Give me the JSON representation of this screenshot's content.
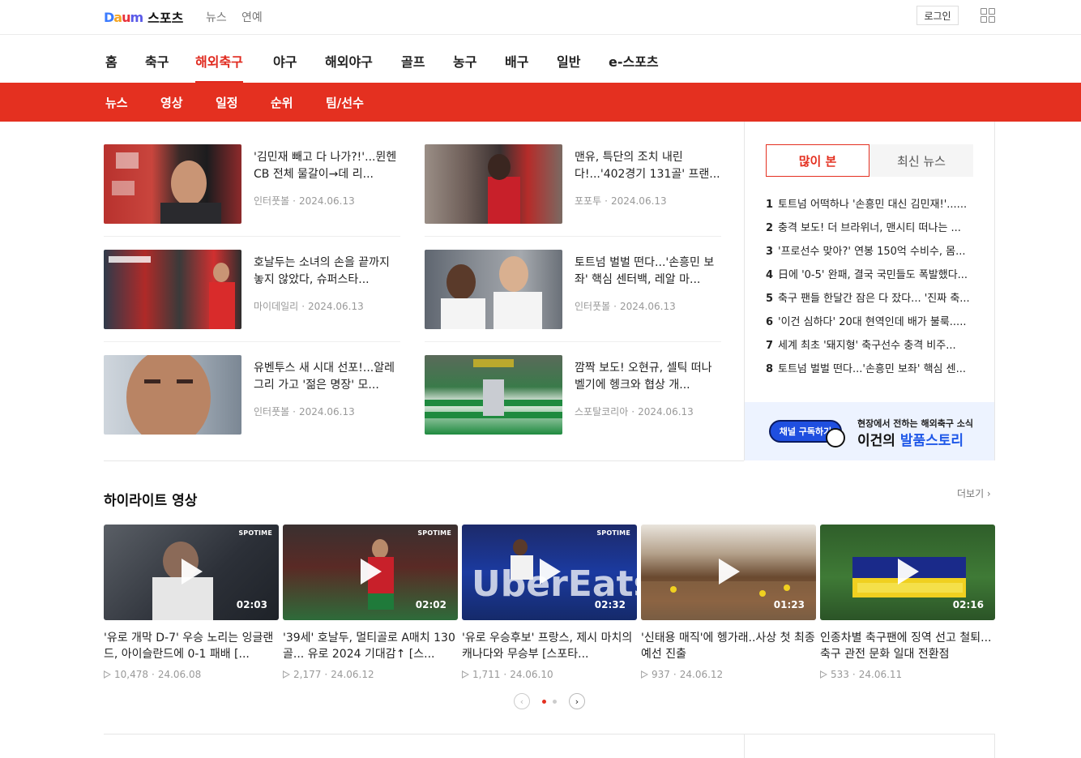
{
  "header": {
    "logo_daum": "Daum",
    "logo_section": "스포츠",
    "links": [
      "뉴스",
      "연예"
    ],
    "login_label": "로그인"
  },
  "main_nav": {
    "items": [
      "홈",
      "축구",
      "해외축구",
      "야구",
      "해외야구",
      "골프",
      "농구",
      "배구",
      "일반",
      "e-스포츠"
    ],
    "active": "해외축구"
  },
  "sub_nav": {
    "items": [
      "뉴스",
      "영상",
      "일정",
      "순위",
      "팀/선수"
    ]
  },
  "news": [
    {
      "title": "'김민재 빼고 다 나가?!'...뮌헨 CB 전체 물갈이→데 리...",
      "source": "인터풋볼",
      "date": "2024.06.13"
    },
    {
      "title": "맨유, 특단의 조치 내린다!...'402경기 131골' 프랜...",
      "source": "포포투",
      "date": "2024.06.13"
    },
    {
      "title": "호날두는 소녀의 손을 끝까지 놓지 않았다, 슈퍼스타...",
      "source": "마이데일리",
      "date": "2024.06.13"
    },
    {
      "title": "토트넘 벌벌 떤다...'손흥민 보좌' 핵심 센터백, 레알 마...",
      "source": "인터풋볼",
      "date": "2024.06.13"
    },
    {
      "title": "유벤투스 새 시대 선포!...알레그리 가고 '젊은 명장' 모...",
      "source": "인터풋볼",
      "date": "2024.06.13"
    },
    {
      "title": "깜짝 보도! 오현규, 셀틱 떠나 벨기에 헹크와 협상 개...",
      "source": "스포탈코리아",
      "date": "2024.06.13"
    }
  ],
  "ranking": {
    "tab_popular": "많이 본",
    "tab_latest": "최신 뉴스",
    "items": [
      {
        "num": "1",
        "title": "토트넘 어떡하나 '손흥민 대신 김민재!'......"
      },
      {
        "num": "2",
        "title": "충격 보도! 더 브라위너, 맨시티 떠나는 ..."
      },
      {
        "num": "3",
        "title": "'프로선수 맞아?' 연봉 150억 수비수, 몸..."
      },
      {
        "num": "4",
        "title": "日에 '0-5' 완패, 결국 국민들도 폭발했다..."
      },
      {
        "num": "5",
        "title": "축구 팬들 한달간 잠은 다 잤다... '진짜 축..."
      },
      {
        "num": "6",
        "title": "'이건 심하다' 20대 현역인데 배가 불룩....."
      },
      {
        "num": "7",
        "title": "세계 최초 '돼지형' 축구선수 충격 비주..."
      },
      {
        "num": "8",
        "title": "토트넘 벌벌 떤다...'손흥민 보좌' 핵심 센..."
      }
    ]
  },
  "promo": {
    "button": "채널 구독하기",
    "sub": "현장에서 전하는 해외축구 소식",
    "main_black": "이건의 ",
    "main_blue": "발품스토리"
  },
  "highlights": {
    "title": "하이라이트 영상",
    "more": "더보기 ›",
    "videos": [
      {
        "title": "'유로 개막 D-7' 우승 노리는 잉글랜드, 아이슬란드에 0-1 패배 [...",
        "duration": "02:03",
        "views": "10,478",
        "date": "24.06.08",
        "brand": "SPOTIME"
      },
      {
        "title": "'39세' 호날두, 멀티골로 A매치 130골... 유로 2024 기대감↑ [스...",
        "duration": "02:02",
        "views": "2,177",
        "date": "24.06.12",
        "brand": "SPOTIME"
      },
      {
        "title": "'유로 우승후보' 프랑스, 제시 마치의 캐나다와 무승부 [스포타...",
        "duration": "02:32",
        "views": "1,711",
        "date": "24.06.10",
        "brand": "SPOTIME"
      },
      {
        "title": "'신태용 매직'에 헹가래..사상 첫 최종예선 진출",
        "duration": "01:23",
        "views": "937",
        "date": "24.06.12",
        "brand": ""
      },
      {
        "title": "인종차별 축구팬에 징역 선고 철퇴...축구 관전 문화 일대 전환점",
        "duration": "02:16",
        "views": "533",
        "date": "24.06.11",
        "brand": ""
      }
    ]
  }
}
